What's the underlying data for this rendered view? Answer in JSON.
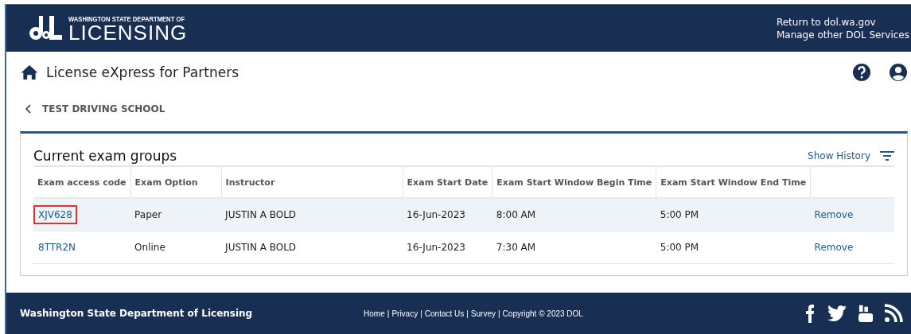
{
  "header": {
    "agency_line": "WASHINGTON STATE DEPARTMENT OF",
    "agency_name": "LICENSING",
    "links": [
      "Return to dol.wa.gov",
      "Manage other DOL Services"
    ]
  },
  "app_title": "License eXpress for Partners",
  "breadcrumb": "TEST DRIVING SCHOOL",
  "card": {
    "title": "Current exam groups",
    "history_link": "Show History",
    "table": {
      "columns": [
        "Exam access code",
        "Exam Option",
        "Instructor",
        "Exam Start Date",
        "Exam Start Window Begin Time",
        "Exam Start Window End Time"
      ],
      "rows": [
        {
          "code": "XJV628",
          "option": "Paper",
          "instructor": "JUSTIN A BOLD",
          "start_date": "16-Jun-2023",
          "begin_time": "8:00 AM",
          "end_time": "5:00 PM",
          "action": "Remove",
          "highlighted": true,
          "outlined": true
        },
        {
          "code": "8TTR2N",
          "option": "Online",
          "instructor": "JUSTIN A BOLD",
          "start_date": "16-Jun-2023",
          "begin_time": "7:30 AM",
          "end_time": "5:00 PM",
          "action": "Remove",
          "highlighted": false,
          "outlined": false
        }
      ]
    }
  },
  "footer": {
    "agency": "Washington State Department of Licensing",
    "links": [
      "Home",
      "Privacy",
      "Contact Us",
      "Survey"
    ],
    "separator": "|",
    "copyright": "Copyright © 2023 DOL"
  }
}
